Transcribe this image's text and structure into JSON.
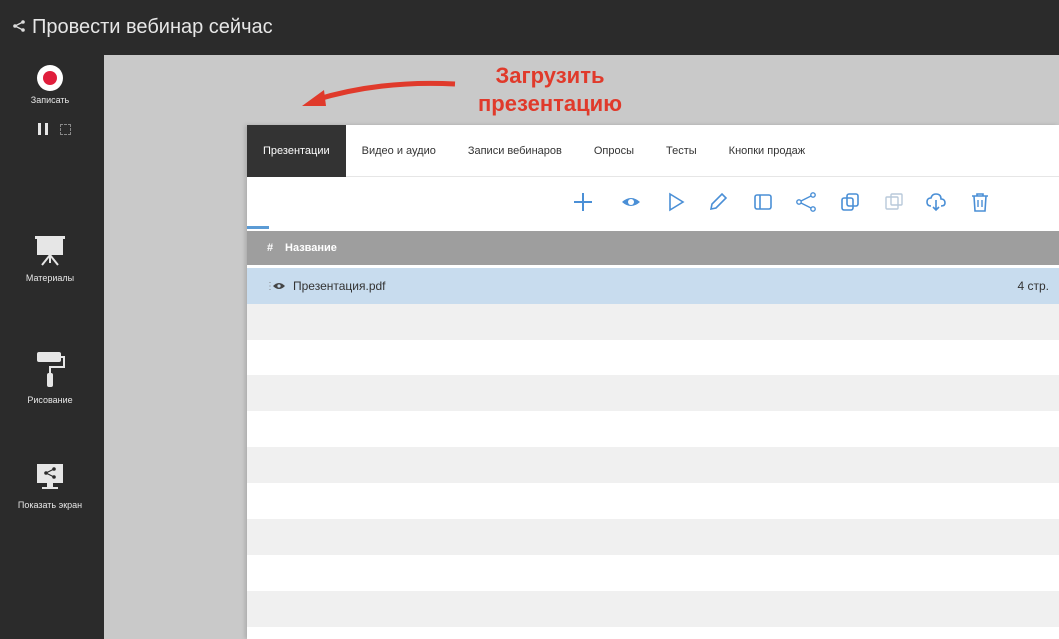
{
  "header": {
    "title": "Провести вебинар сейчас",
    "share_icon": "share-icon"
  },
  "sidebar": {
    "record_label": "Записать",
    "record_color": "#e01e3c",
    "tools": [
      {
        "label": "Материалы",
        "icon": "presentation-board-icon"
      },
      {
        "label": "Рисование",
        "icon": "paint-roller-icon"
      },
      {
        "label": "Показать экран",
        "icon": "screen-share-icon"
      }
    ]
  },
  "annotation": {
    "line1": "Загрузить",
    "line2": "презентацию",
    "color": "#e03a2b"
  },
  "tabs": [
    {
      "label": "Презентации",
      "active": true
    },
    {
      "label": "Видео и аудио"
    },
    {
      "label": "Записи вебинаров"
    },
    {
      "label": "Опросы"
    },
    {
      "label": "Тесты"
    },
    {
      "label": "Кнопки продаж"
    }
  ],
  "toolbar": {
    "icons": [
      "plus-icon",
      "eye-icon",
      "play-icon",
      "pencil-icon",
      "panel-icon",
      "share-icon",
      "copy-icon",
      "duplicate-icon",
      "cloud-download-icon",
      "trash-icon"
    ]
  },
  "table": {
    "header_hash": "#",
    "header_name": "Название",
    "rows": [
      {
        "name": "Презентация.pdf",
        "pages": "4 стр."
      }
    ]
  }
}
